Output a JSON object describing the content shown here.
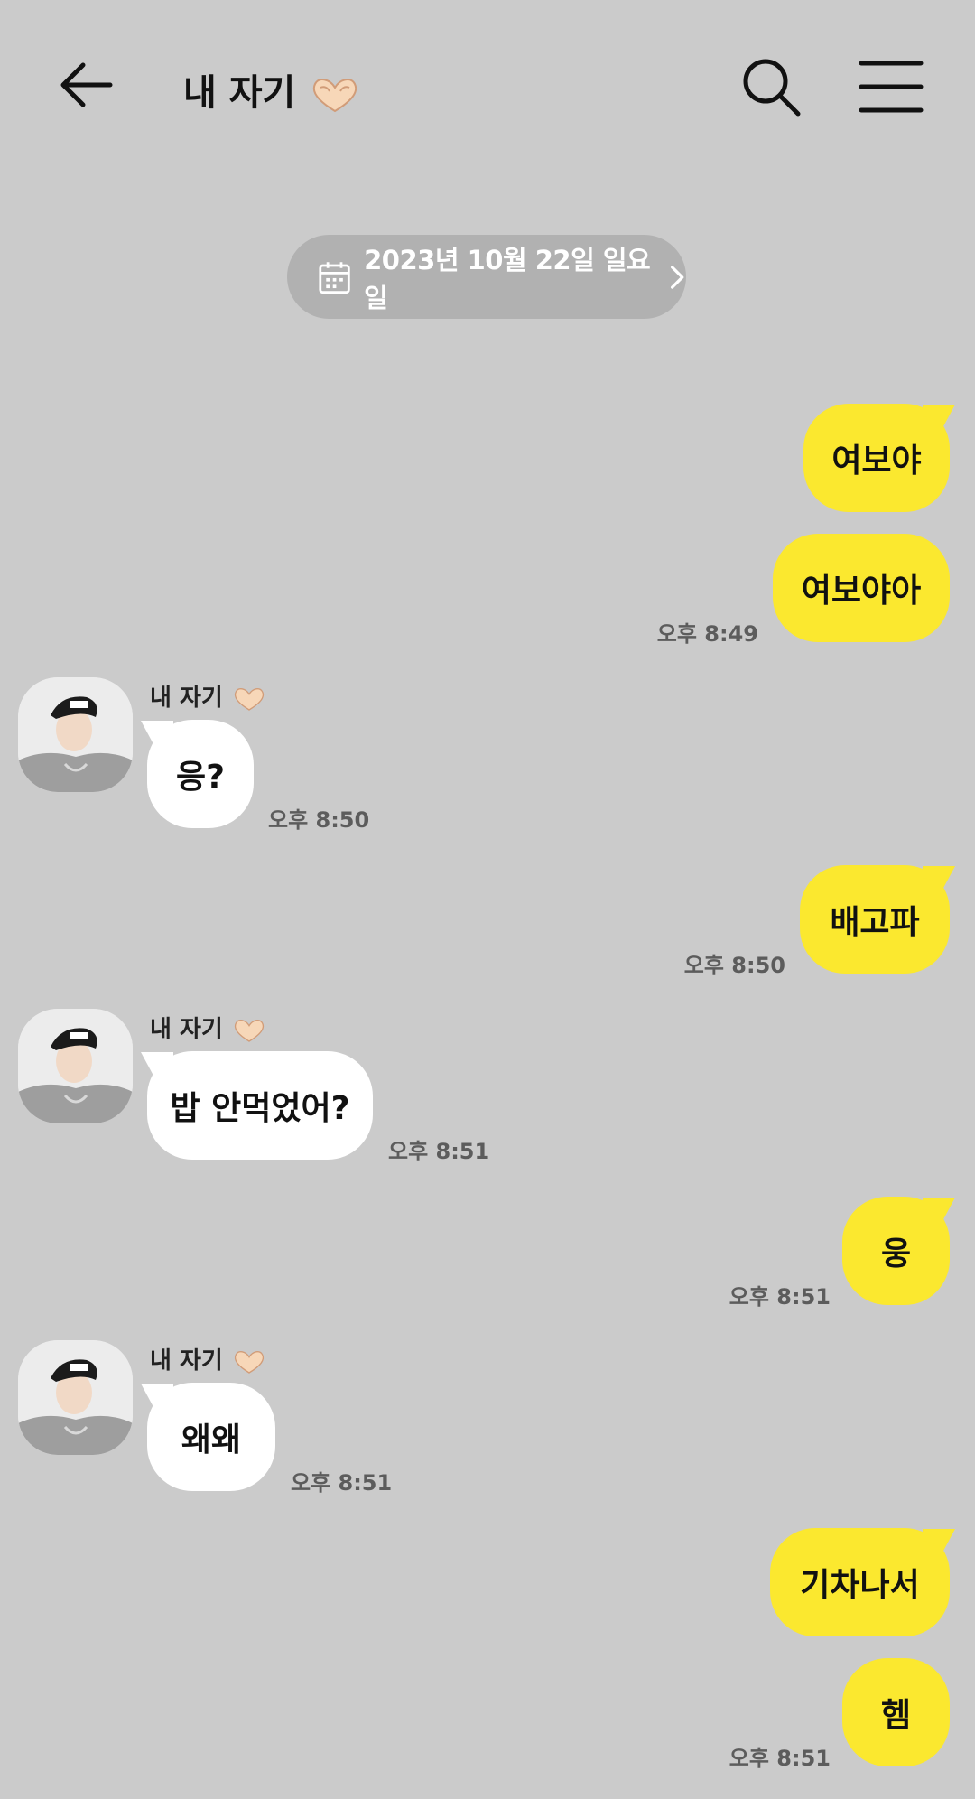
{
  "header": {
    "title": "내 자기",
    "back_icon": "arrow-left-icon",
    "search_icon": "search-icon",
    "menu_icon": "hamburger-menu-icon"
  },
  "date_divider": {
    "text": "2023년 10월 22일 일요일",
    "icon": "calendar-icon"
  },
  "colors": {
    "background": "#cbcbcb",
    "my_bubble": "#fbe82f",
    "their_bubble": "#ffffff",
    "date_pill": "#b1b1b1"
  },
  "messages": [
    {
      "sender": "me",
      "text": "여보야"
    },
    {
      "sender": "me",
      "text": "여보야아",
      "time": "오후 8:49"
    },
    {
      "sender": "them",
      "name": "내 자기",
      "text": "응?",
      "time": "오후 8:50"
    },
    {
      "sender": "me",
      "text": "배고파",
      "time": "오후 8:50"
    },
    {
      "sender": "them",
      "name": "내 자기",
      "text": "밥 안먹었어?",
      "time": "오후 8:51"
    },
    {
      "sender": "me",
      "text": "웅",
      "time": "오후 8:51"
    },
    {
      "sender": "them",
      "name": "내 자기",
      "text": "왜왜",
      "time": "오후 8:51"
    },
    {
      "sender": "me",
      "text": "기차나서"
    },
    {
      "sender": "me",
      "text": "헴",
      "time": "오후 8:51"
    }
  ]
}
